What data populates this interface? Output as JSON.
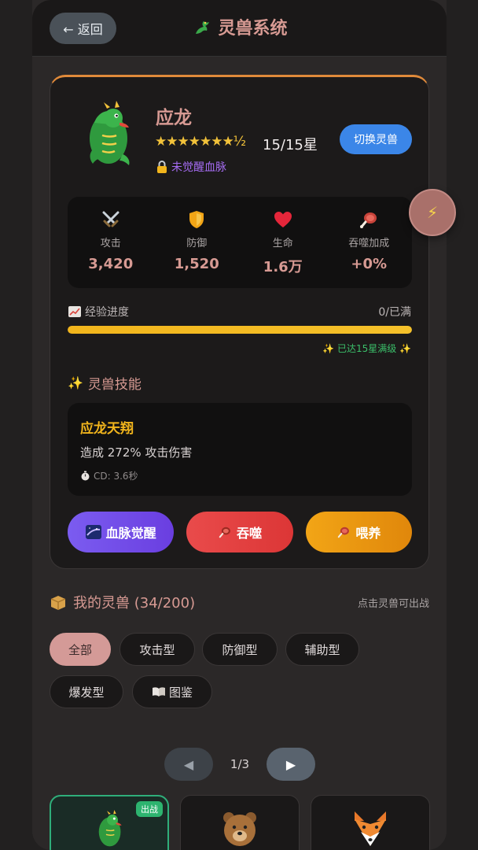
{
  "header": {
    "back_label": "← 返回",
    "title": "灵兽系统",
    "title_icon": "dragon-icon"
  },
  "beast": {
    "name": "应龙",
    "rating": 7.5,
    "stars_text": "★★★★★★★½",
    "star_count": "15/15星",
    "bloodline": "未觉醒血脉",
    "switch_label": "切换灵兽"
  },
  "stats": [
    {
      "icon": "swords-icon",
      "label": "攻击",
      "value": "3,420"
    },
    {
      "icon": "shield-icon",
      "label": "防御",
      "value": "1,520"
    },
    {
      "icon": "heart-icon",
      "label": "生命",
      "value": "1.6万"
    },
    {
      "icon": "meat-icon",
      "label": "吞噬加成",
      "value": "+0%"
    }
  ],
  "exp": {
    "label": "经验进度",
    "value": "0/已满",
    "progress": 1.0,
    "max_note": "✨ 已达15星满级 ✨"
  },
  "skill": {
    "heading": "灵兽技能",
    "name": "应龙天翔",
    "description": "造成 272% 攻击伤害",
    "cooldown": "CD: 3.6秒"
  },
  "actions": {
    "awaken": "血脉觉醒",
    "devour": "吞噬",
    "feed": "喂养"
  },
  "collection": {
    "heading": "我的灵兽 (34/200)",
    "hint": "点击灵兽可出战",
    "filters": [
      "全部",
      "攻击型",
      "防御型",
      "辅助型",
      "爆发型",
      "图鉴"
    ],
    "active_filter": "全部"
  },
  "pager": {
    "text": "1/3"
  },
  "beast_cards": [
    {
      "icon": "dragon-icon",
      "badge": "出战"
    },
    {
      "icon": "bear-icon"
    },
    {
      "icon": "fox-icon"
    }
  ],
  "colors": {
    "accent": "#d79a93",
    "gold": "#f2b51c",
    "switch_blue": "#3b86e8",
    "deploy_green": "#2db46f"
  }
}
